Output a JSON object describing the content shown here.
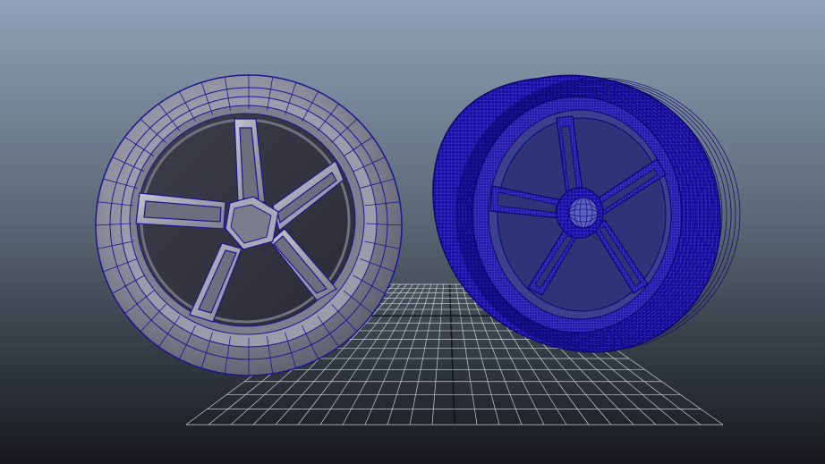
{
  "viewport": {
    "gradient_top": "#8fa2b7",
    "gradient_mid": "#5a6674",
    "gradient_bottom": "#15171a"
  },
  "grid": {
    "color": "#c9ccd2",
    "axis_color": "#111111"
  },
  "objects": [
    {
      "name": "wheel-low-poly",
      "display": "shaded-wireframe",
      "surface_color": "#8d8f9f",
      "wire_color": "#1d1690"
    },
    {
      "name": "wheel-high-poly",
      "display": "dense-wireframe",
      "surface_color": "#1a0fa0",
      "wire_color": "#3d34c9"
    }
  ]
}
